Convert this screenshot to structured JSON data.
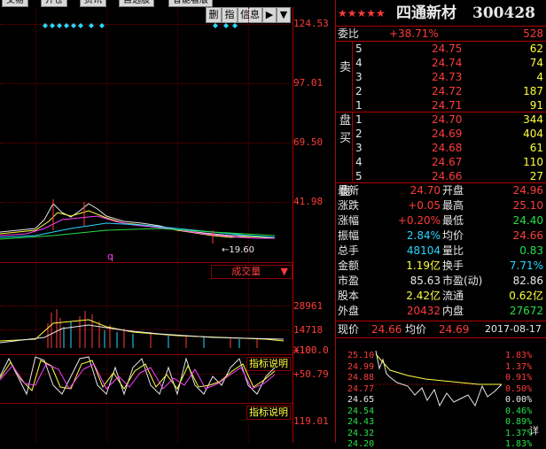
{
  "toolbar": {
    "btn1": "交易",
    "btn2": "开仓",
    "btn3": "资讯",
    "btn4": "自选股",
    "btn5": "智能看版"
  },
  "tabs": {
    "delete": "删",
    "index": "指",
    "info": "信息",
    "arrow": "▶"
  },
  "chart": {
    "y_labels_main": [
      "124.53",
      "97.01",
      "69.50",
      "41.98"
    ],
    "low_marker": "19.60",
    "q_marker": "q",
    "volume_dropdown": "成交量",
    "y_labels_vol": [
      "28961",
      "14718",
      "X10"
    ],
    "indicator_btn": "指标说明",
    "y_labels_ind": [
      "+100.0",
      "+50.79"
    ],
    "indicator_btn2": "指标说明",
    "y_label_last": "119.01"
  },
  "stock": {
    "stars": "★★★★★",
    "name": "四通新材",
    "code": "300428",
    "weibi_label": "委比",
    "weibi_value": "+38.71%",
    "weibi_diff": "528",
    "sell_label": "卖盘",
    "buy_label": "买盘",
    "sells": [
      {
        "level": "5",
        "price": "24.75",
        "vol": "62"
      },
      {
        "level": "4",
        "price": "24.74",
        "vol": "74"
      },
      {
        "level": "3",
        "price": "24.73",
        "vol": "4"
      },
      {
        "level": "2",
        "price": "24.72",
        "vol": "187"
      },
      {
        "level": "1",
        "price": "24.71",
        "vol": "91"
      }
    ],
    "buys": [
      {
        "level": "1",
        "price": "24.70",
        "vol": "344"
      },
      {
        "level": "2",
        "price": "24.69",
        "vol": "404"
      },
      {
        "level": "3",
        "price": "24.68",
        "vol": "61"
      },
      {
        "level": "4",
        "price": "24.67",
        "vol": "110"
      },
      {
        "level": "5",
        "price": "24.66",
        "vol": "27"
      }
    ],
    "stats": [
      {
        "l1": "最新",
        "v1": "24.70",
        "l2": "开盘",
        "v2": "24.96"
      },
      {
        "l1": "涨跌",
        "v1": "+0.05",
        "l2": "最高",
        "v2": "25.10"
      },
      {
        "l1": "涨幅",
        "v1": "+0.20%",
        "l2": "最低",
        "v2": "24.40"
      },
      {
        "l1": "振幅",
        "v1": "2.84%",
        "l2": "均价",
        "v2": "24.66"
      },
      {
        "l1": "总手",
        "v1": "48104",
        "l2": "量比",
        "v2": "0.83"
      },
      {
        "l1": "金额",
        "v1": "1.19亿",
        "l2": "换手",
        "v2": "7.71%"
      },
      {
        "l1": "市盈",
        "v1": "85.63",
        "l2": "市盈(动)",
        "v2": "82.86"
      },
      {
        "l1": "股本",
        "v1": "2.42亿",
        "l2": "流通",
        "v2": "0.62亿"
      },
      {
        "l1": "外盘",
        "v1": "20432",
        "l2": "内盘",
        "v2": "27672"
      }
    ],
    "mini_header": {
      "l1": "现价",
      "v1": "24.66",
      "l2": "均价",
      "v2": "24.69",
      "date": "2017-08-17"
    },
    "mini_left": [
      "25.10",
      "24.99",
      "24.88",
      "24.77",
      "24.65",
      "24.54",
      "24.43",
      "24.32",
      "24.20"
    ],
    "mini_right": [
      "1.83%",
      "1.37%",
      "0.91%",
      "0.50%",
      "0.00%",
      "0.46%",
      "0.89%",
      "1.37%",
      "1.83%"
    ],
    "mini_suffix": "详"
  },
  "colors": {
    "up": "#ff3b3b",
    "down": "#26e04a",
    "neutral": "#e8e8e8",
    "grid": "#8b0000",
    "vol_label": "#28d7ff"
  }
}
